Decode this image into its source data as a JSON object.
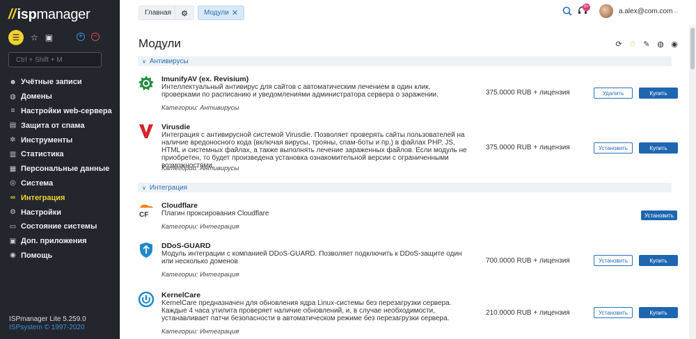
{
  "sidebar": {
    "logo_isp": "isp",
    "logo_manager": "manager",
    "search_placeholder": "Ctrl + Shift + M",
    "items": [
      {
        "label": "Учётные записи",
        "icon": "users-icon"
      },
      {
        "label": "Домены",
        "icon": "globe-icon"
      },
      {
        "label": "Настройки web-сервера",
        "icon": "sliders-icon"
      },
      {
        "label": "Защита от спама",
        "icon": "spam-shield-icon"
      },
      {
        "label": "Инструменты",
        "icon": "gear-icon"
      },
      {
        "label": "Статистика",
        "icon": "chart-icon"
      },
      {
        "label": "Персональные данные",
        "icon": "id-card-icon"
      },
      {
        "label": "Система",
        "icon": "system-icon"
      },
      {
        "label": "Интеграция",
        "icon": "integration-icon"
      },
      {
        "label": "Настройки",
        "icon": "settings-icon"
      },
      {
        "label": "Состояние системы",
        "icon": "monitor-icon"
      },
      {
        "label": "Доп. приложения",
        "icon": "apps-icon"
      },
      {
        "label": "Помощь",
        "icon": "help-icon"
      }
    ],
    "version": "ISPmanager Lite 5.259.0",
    "copyright": "ISPsystem © 1997-2020"
  },
  "header": {
    "crumbs": [
      "Главная",
      "Модули"
    ],
    "notification_count": "9+",
    "user": "a.alex@com.com"
  },
  "main": {
    "title": "Модули",
    "sections": [
      {
        "label": "Антивирусы"
      },
      {
        "label": "Интеграция"
      }
    ],
    "modules": [
      {
        "name": "ImunifyAV (ex. Revisium)",
        "desc": "Интеллектуальный антивирус для сайтов с автоматическим лечением в один клик, проверками по расписанию и уведомлениями администратора сервера о заражении.",
        "category": "Категории: Антивирусы",
        "price": "375.0000 RUB + лицензия",
        "action": "Удалить",
        "buy": "Купить"
      },
      {
        "name": "Virusdie",
        "desc": "Интеграция с антивирусной системой Virusdie. Позволяет проверять сайты пользователей на наличие вредоносного кода (включая вирусы, трояны, спам-боты и пр.) в файлах PHP, JS, HTML и системных файлах, а также выполнять лечение зараженных файлов. Если модуль не приобретен, то будет произведена установка ознакомительной версии с ограниченными возможностями.",
        "category": "Категории: Антивирусы",
        "price": "375.0000 RUB + лицензия",
        "action": "Установить",
        "buy": "Купить"
      },
      {
        "name": "Cloudflare",
        "desc": "Плагин проксирования Cloudflare",
        "category": "Категории: Интеграция",
        "price": "",
        "action": "Установить"
      },
      {
        "name": "DDoS-GUARD",
        "desc": "Модуль интеграции с компанией DDoS-GUARD. Позволяет подключить к DDoS-защите один или несколько доменов",
        "category": "Категории: Интеграция",
        "price": "700.0000 RUB + лицензия",
        "action": "Установить",
        "buy": "Купить"
      },
      {
        "name": "KernelCare",
        "desc": "KernelCare предназначен для обновления ядра Linux-системы без перезагрузки сервера. Каждые 4 часа утилита проверяет наличие обновлений, и, в случае необходимости, устанавливает патчи безопасности в автоматическом режиме без перезагрузки сервера.",
        "category": "Категории: Интеграция",
        "price": "210.0000 RUB + лицензия",
        "action": "Установить",
        "buy": "Купить"
      }
    ]
  },
  "colors": {
    "accent": "#f2d22e",
    "primary": "#1f66b0",
    "sidebar": "#23262d"
  }
}
